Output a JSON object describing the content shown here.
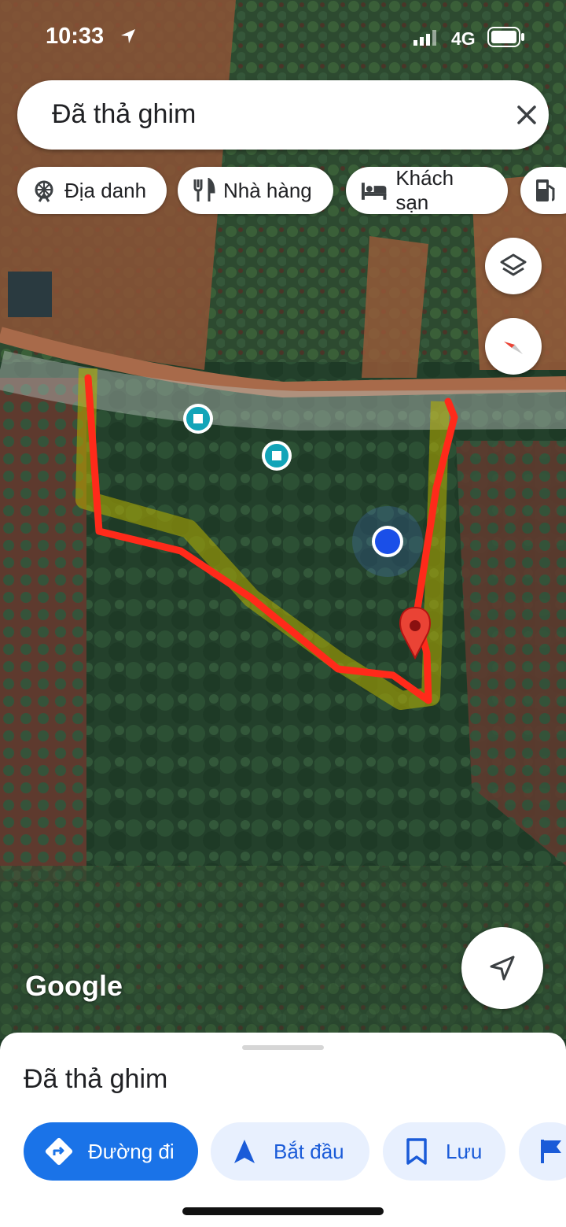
{
  "status_bar": {
    "time": "10:33",
    "network": "4G"
  },
  "search": {
    "query": "Đã thả ghim",
    "close_icon": "close-icon"
  },
  "chips": [
    {
      "label": "Địa danh",
      "icon": "attractions-icon"
    },
    {
      "label": "Nhà hàng",
      "icon": "restaurant-icon"
    },
    {
      "label": "Khách sạn",
      "icon": "hotel-icon"
    },
    {
      "label": "",
      "icon": "gas-station-icon"
    }
  ],
  "map": {
    "attribution": "Google",
    "boundary_color": "#ff2a1a",
    "pin_color": "#ea4335",
    "user_location_color": "#1a4fe8",
    "poi_color": "#12a4b8"
  },
  "sheet": {
    "title": "Đã thả ghim",
    "actions": [
      {
        "label": "Đường đi",
        "icon": "directions-icon"
      },
      {
        "label": "Bắt đầu",
        "icon": "navigation-icon"
      },
      {
        "label": "Lưu",
        "icon": "bookmark-icon"
      },
      {
        "label": "",
        "icon": "flag-icon"
      }
    ]
  }
}
